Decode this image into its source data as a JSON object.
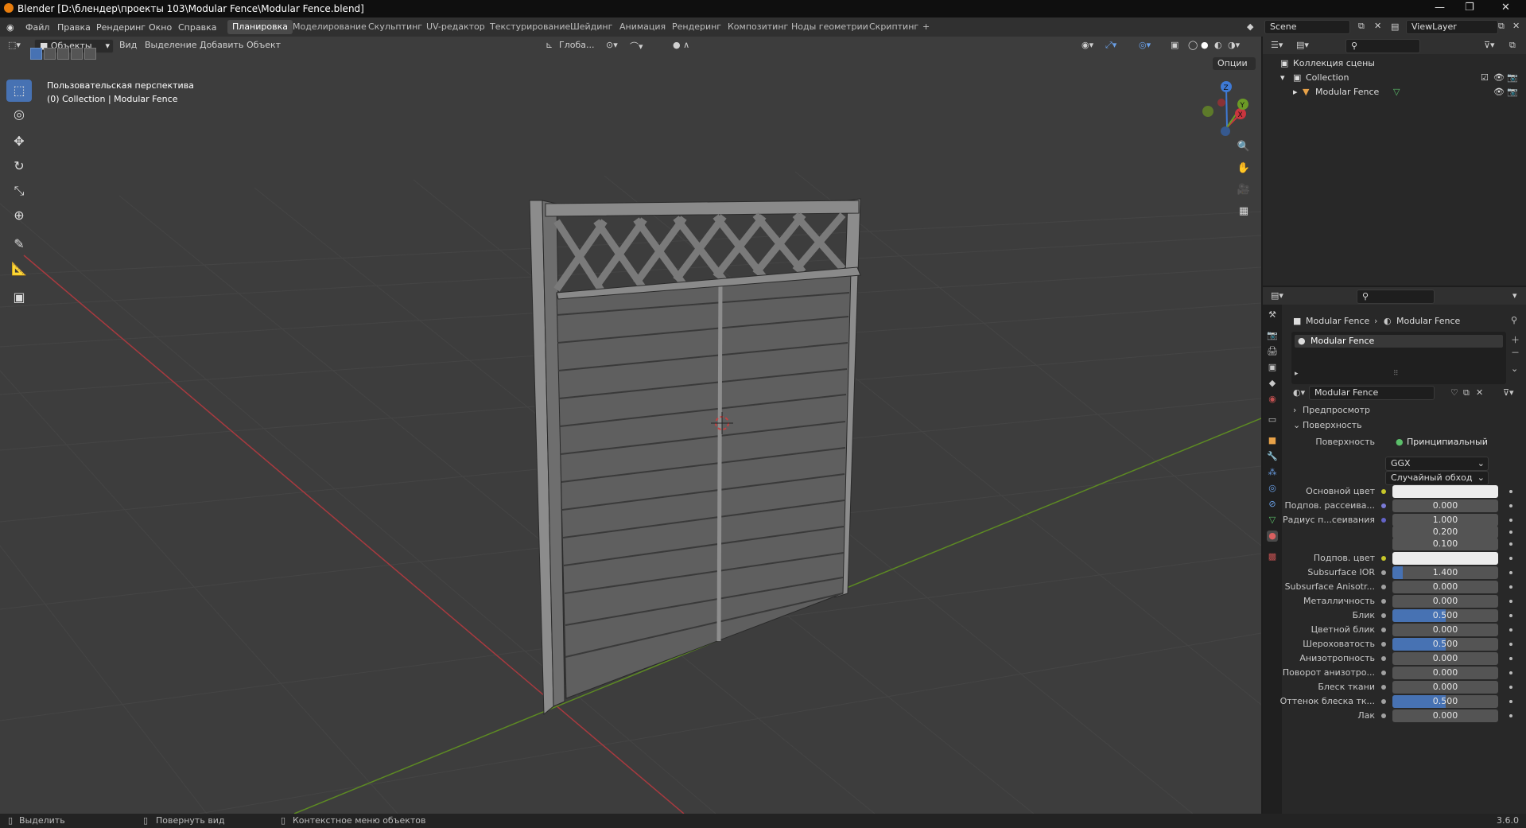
{
  "window": {
    "title": "Blender [D:\\блендер\\проекты 103\\Modular Fence\\Modular Fence.blend]",
    "minimize": "—",
    "maximize": "❐",
    "close": "✕"
  },
  "menu": [
    "Файл",
    "Правка",
    "Рендеринг",
    "Окно",
    "Справка"
  ],
  "workspaces": [
    "Планировка",
    "Моделирование",
    "Скульптинг",
    "UV-редактор",
    "Текстурирование",
    "Шейдинг",
    "Анимация",
    "Рендеринг",
    "Композитинг",
    "Ноды геометрии",
    "Скриптинг"
  ],
  "workspace_add": "+",
  "scene": {
    "name": "Scene",
    "view_layer": "ViewLayer"
  },
  "viewport": {
    "mode": "Объекты",
    "menus": [
      "Вид",
      "Выделение",
      "Добавить",
      "Объект"
    ],
    "transform_orientation": "Глоба...",
    "options": "Опции",
    "overlay_line1": "Пользовательская перспектива",
    "overlay_line2": "(0) Collection | Modular Fence",
    "gizmo": {
      "x": "X",
      "y": "Y",
      "z": "Z"
    }
  },
  "outliner": {
    "root": "Коллекция сцены",
    "collection": "Collection",
    "object": "Modular Fence"
  },
  "properties": {
    "breadcrumb_object": "Modular Fence",
    "breadcrumb_material": "Modular Fence",
    "slot": "Modular Fence",
    "material_name": "Modular Fence",
    "section_preview": "Предпросмотр",
    "section_surface": "Поверхность",
    "surface_label": "Поверхность",
    "surface_value": "Принципиальный BSDF",
    "distribution": "GGX",
    "subsurface_method": "Случайный обход",
    "params": [
      {
        "label": "Основной цвет",
        "value": "",
        "type": "color",
        "dot": "#c7c729"
      },
      {
        "label": "Подпов. рассеива...",
        "value": "0.000",
        "fill": 0,
        "dot": "#7a7ad6"
      },
      {
        "label": "Радиус п...сеивания",
        "value": "1.000",
        "fill": 0,
        "dot": "#6363c7"
      },
      {
        "label": "",
        "value": "0.200",
        "fill": 0,
        "dot": ""
      },
      {
        "label": "",
        "value": "0.100",
        "fill": 0,
        "dot": ""
      },
      {
        "label": "Подпов. цвет",
        "value": "",
        "type": "color",
        "dot": "#c7c729"
      },
      {
        "label": "Subsurface IOR",
        "value": "1.400",
        "fill": 0.1,
        "dot": "#a1a1a1"
      },
      {
        "label": "Subsurface Anisotr...",
        "value": "0.000",
        "fill": 0,
        "dot": "#a1a1a1"
      },
      {
        "label": "Металличность",
        "value": "0.000",
        "fill": 0,
        "dot": "#a1a1a1"
      },
      {
        "label": "Блик",
        "value": "0.500",
        "fill": 0.5,
        "dot": "#a1a1a1"
      },
      {
        "label": "Цветной блик",
        "value": "0.000",
        "fill": 0,
        "dot": "#a1a1a1"
      },
      {
        "label": "Шероховатость",
        "value": "0.500",
        "fill": 0.5,
        "dot": "#a1a1a1"
      },
      {
        "label": "Анизотропность",
        "value": "0.000",
        "fill": 0,
        "dot": "#a1a1a1"
      },
      {
        "label": "Поворот анизотро...",
        "value": "0.000",
        "fill": 0,
        "dot": "#a1a1a1"
      },
      {
        "label": "Блеск ткани",
        "value": "0.000",
        "fill": 0,
        "dot": "#a1a1a1"
      },
      {
        "label": "Оттенок блеска тк...",
        "value": "0.500",
        "fill": 0.5,
        "dot": "#a1a1a1"
      },
      {
        "label": "Лак",
        "value": "0.000",
        "fill": 0,
        "dot": "#a1a1a1"
      }
    ]
  },
  "statusbar": {
    "select": "Выделить",
    "rotate": "Повернуть вид",
    "context": "Контекстное меню объектов",
    "version": "3.6.0"
  },
  "colors": {
    "accent": "#4772b3",
    "x_axis": "#c9353e",
    "y_axis": "#6b9a26",
    "z_axis": "#3e7ad6",
    "viewport_bg": "#3d3d3d",
    "panel_bg": "#282828"
  }
}
